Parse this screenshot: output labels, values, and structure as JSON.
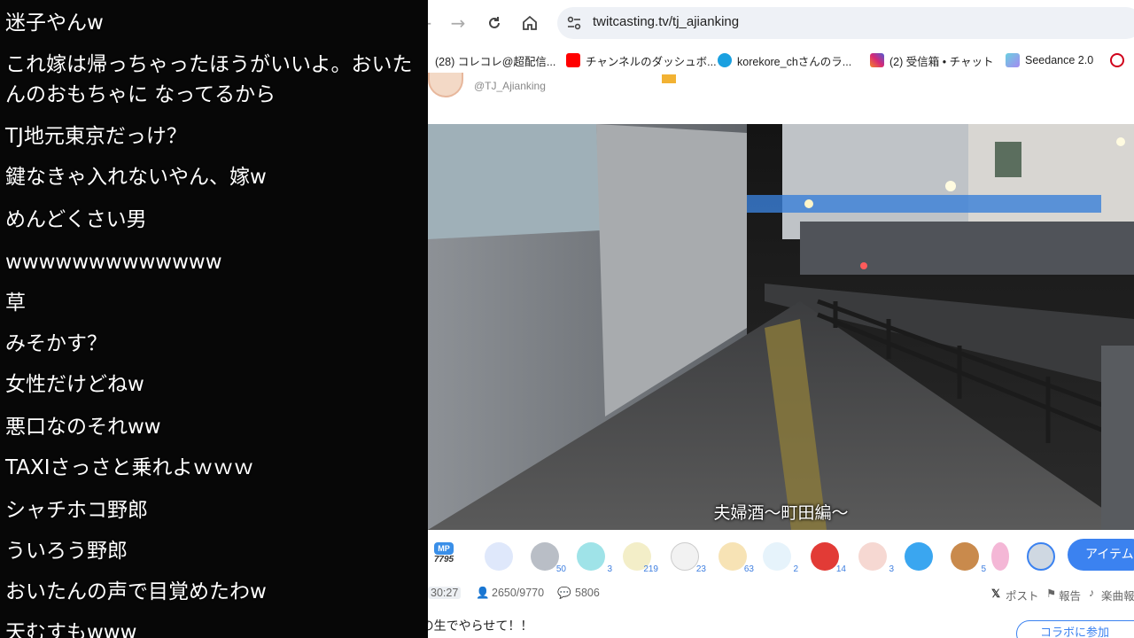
{
  "comments": [
    "迷子やんw",
    "これ嫁は帰っちゃったほうがいいよ。おいたんのおもちゃに なってるから",
    "TJ地元東京だっけ？",
    "鍵なきゃ入れないやん、嫁w",
    "めんどくさい男",
    "wwwwwwwwwwwww",
    "草",
    "みそかす？",
    "女性だけどねw",
    "悪口なのそれww",
    "TAXIさっさと乗れよｗｗｗ",
    "シャチホコ野郎",
    "ういろう野郎",
    "おいたんの声で目覚めたわw",
    "天むすもwww"
  ],
  "browser": {
    "url": "twitcasting.tv/tj_ajianking",
    "bookmarks": [
      {
        "label": "(28) コレコレ@超配信...",
        "color": "#1d9bf0"
      },
      {
        "label": "チャンネルのダッシュボ...",
        "color": "#ff0000"
      },
      {
        "label": "korekore_chさんのラ...",
        "color": "#1aa0e0"
      },
      {
        "label": "(2) 受信箱 • チャット",
        "color": "#d62976"
      },
      {
        "label": "Seedance 2.0",
        "color": "#6ad0e0"
      }
    ]
  },
  "broadcaster": {
    "handle": "@TJ_Ajianking"
  },
  "video": {
    "subtitle": "夫婦酒〜町田編〜"
  },
  "gifts": {
    "mp_label": "MP",
    "mp_count": "7795",
    "items": [
      {
        "count": "",
        "color": "#dfe8fb"
      },
      {
        "count": "50",
        "color": "#b9bec6"
      },
      {
        "count": "3",
        "color": "#9fe3e8"
      },
      {
        "count": "219",
        "color": "#f3eec8"
      },
      {
        "count": "23",
        "color": "#f2f2f2"
      },
      {
        "count": "63",
        "color": "#f7e3b5"
      },
      {
        "count": "2",
        "color": "#e6f3fb"
      },
      {
        "count": "14",
        "color": "#e23b36"
      },
      {
        "count": "3",
        "color": "#f6d8d2"
      },
      {
        "count": "",
        "color": "#3aa6f0"
      },
      {
        "count": "5",
        "color": "#c98a4c"
      },
      {
        "count": "",
        "color": "#f4b7d6"
      },
      {
        "count": "",
        "color": "#cfd8e2"
      }
    ],
    "item_button": "アイテム"
  },
  "stats": {
    "elapsed": "30:27",
    "viewers": "2650/9770",
    "comments": "5806",
    "post": "ポスト",
    "report": "報告",
    "music": "楽曲報"
  },
  "live": {
    "title": "TJの生でやらせて！！",
    "collab_button": "コラボに参加"
  }
}
